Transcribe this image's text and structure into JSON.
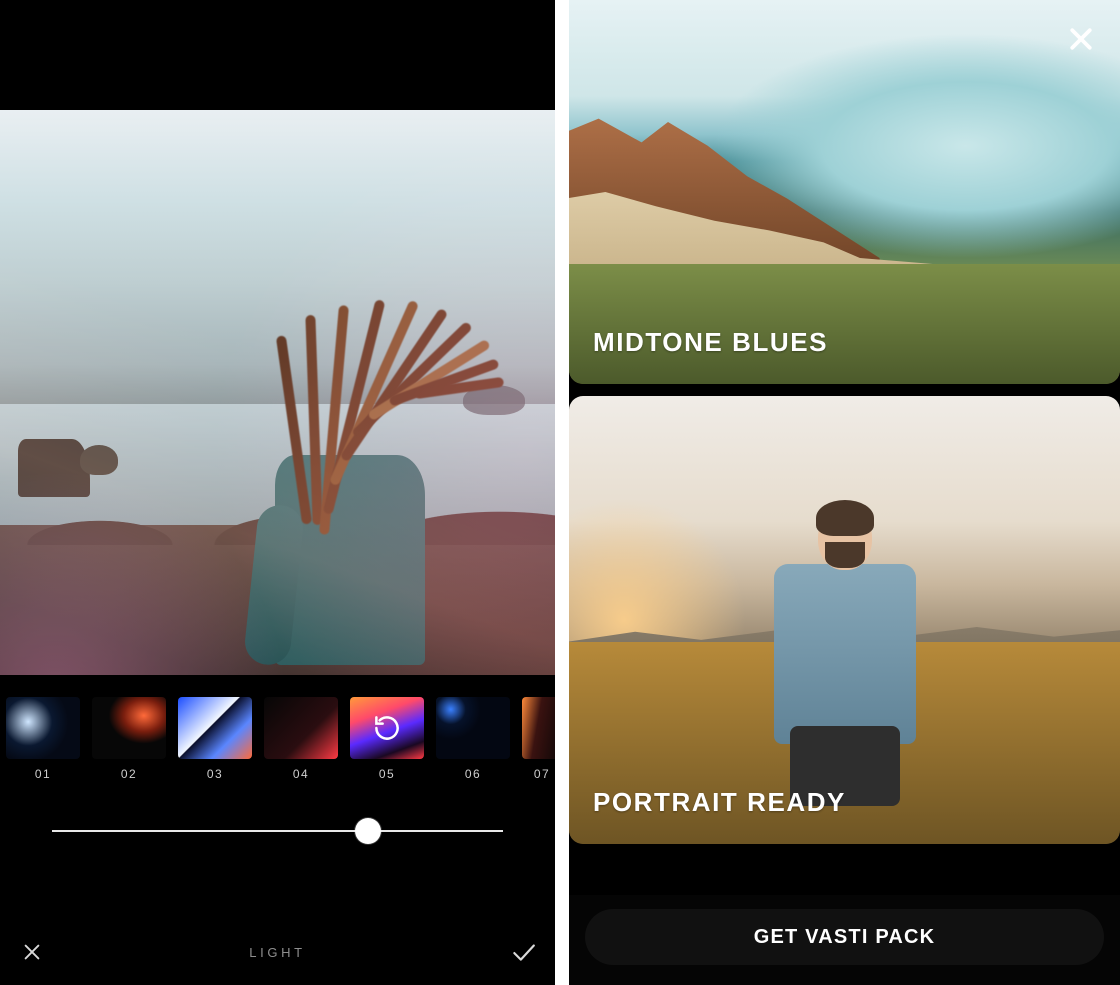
{
  "editor": {
    "tool_label": "LIGHT",
    "slider": {
      "min": 0,
      "max": 100,
      "value": 70
    },
    "filters": [
      {
        "id": "01",
        "label": "01",
        "selected": false
      },
      {
        "id": "02",
        "label": "02",
        "selected": false
      },
      {
        "id": "03",
        "label": "03",
        "selected": false
      },
      {
        "id": "04",
        "label": "04",
        "selected": false
      },
      {
        "id": "05",
        "label": "05",
        "selected": true
      },
      {
        "id": "06",
        "label": "06",
        "selected": false
      },
      {
        "id": "07",
        "label": "07",
        "selected": false
      }
    ],
    "icons": {
      "cancel": "close-icon",
      "confirm": "check-icon",
      "reset": "reset-icon"
    }
  },
  "pack": {
    "close_icon": "close-icon",
    "cards": [
      {
        "title": "MIDTONE BLUES"
      },
      {
        "title": "PORTRAIT READY"
      }
    ],
    "cta_label": "GET VASTI PACK"
  }
}
